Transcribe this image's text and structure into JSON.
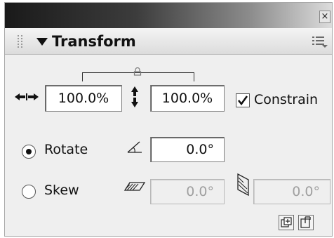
{
  "panel": {
    "close_glyph": "×",
    "title": "Transform",
    "icons": {
      "collapse": "triangle-down-icon",
      "grip": "grip-icon",
      "menu": "options-menu-icon",
      "close": "close-icon"
    }
  },
  "scale": {
    "width_value": "100.0%",
    "height_value": "100.0%",
    "constrain_label": "Constrain",
    "constrain_checked": true
  },
  "rotate": {
    "label": "Rotate",
    "selected": true,
    "value": "0.0°"
  },
  "skew": {
    "label": "Skew",
    "selected": false,
    "horizontal_value": "0.0°",
    "vertical_value": "0.0°"
  },
  "buttons": {
    "copy_and_transform": "copy-and-transform-icon",
    "reset": "reset-icon"
  },
  "colors": {
    "panel_bg": "#efefef",
    "field_bg": "#ffffff",
    "disabled_text": "#a0a0a0"
  }
}
